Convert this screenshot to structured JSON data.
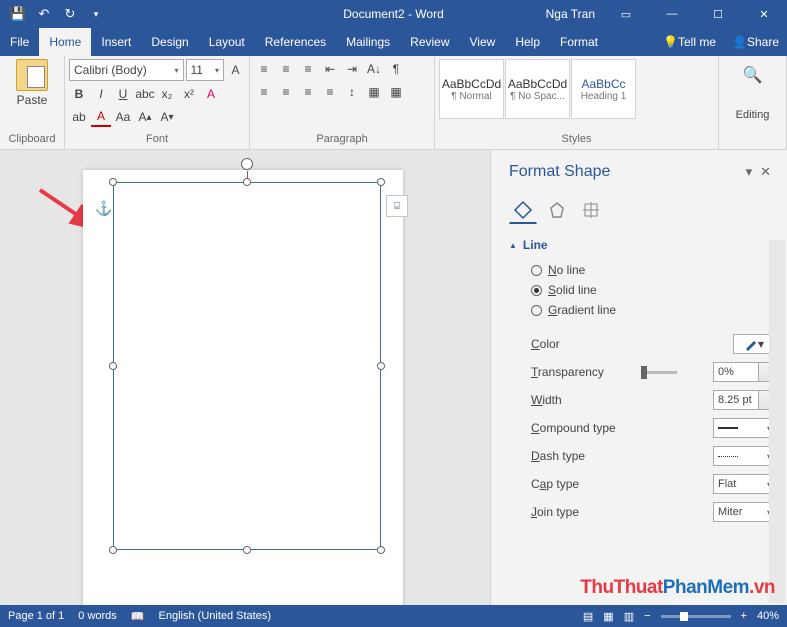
{
  "titlebar": {
    "doc_title": "Document2 - Word",
    "user": "Nga Tran"
  },
  "tabs": {
    "file": "File",
    "home": "Home",
    "insert": "Insert",
    "design": "Design",
    "layout": "Layout",
    "references": "References",
    "mailings": "Mailings",
    "review": "Review",
    "view": "View",
    "help": "Help",
    "format": "Format",
    "tellme": "Tell me",
    "share": "Share"
  },
  "ribbon": {
    "clipboard": {
      "paste": "Paste",
      "label": "Clipboard"
    },
    "font": {
      "name": "Calibri (Body)",
      "size": "11",
      "label": "Font",
      "bold": "B",
      "italic": "I",
      "underline": "U"
    },
    "paragraph": {
      "label": "Paragraph"
    },
    "styles": {
      "label": "Styles",
      "preview": "AaBbCcDd",
      "s1": "¶ Normal",
      "s2": "¶ No Spac...",
      "s3": "Heading 1",
      "preview3": "AaBbCc"
    },
    "editing": {
      "label": "Editing"
    }
  },
  "pane": {
    "title": "Format Shape",
    "section": "Line",
    "no_line": "No line",
    "solid_line": "Solid line",
    "gradient_line": "Gradient line",
    "color": "Color",
    "transparency": "Transparency",
    "transparency_val": "0%",
    "width": "Width",
    "width_val": "8.25 pt",
    "compound": "Compound type",
    "dash": "Dash type",
    "cap": "Cap type",
    "cap_val": "Flat",
    "join": "Join type",
    "join_val": "Miter"
  },
  "status": {
    "page": "Page 1 of 1",
    "words": "0 words",
    "lang": "English (United States)",
    "zoom": "40%"
  },
  "watermark": {
    "a": "ThuThuat",
    "b": "PhanMem",
    "c": ".vn"
  }
}
